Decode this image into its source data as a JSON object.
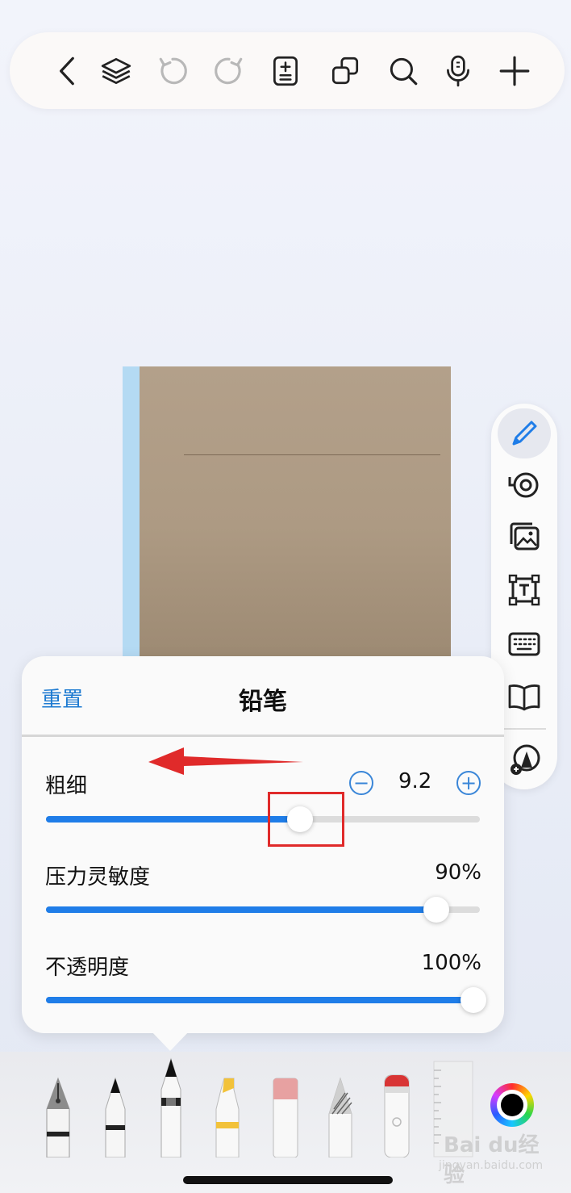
{
  "panel": {
    "reset_label": "重置",
    "title": "铅笔",
    "thickness": {
      "label": "粗细",
      "value": "9.2",
      "minus": "−",
      "plus": "+",
      "fraction": 0.585
    },
    "pressure": {
      "label": "压力灵敏度",
      "value": "90%",
      "fraction": 0.9
    },
    "opacity": {
      "label": "不透明度",
      "value": "100%",
      "fraction": 1.0
    }
  },
  "watermark": {
    "text": "Bai du经验",
    "sub": "jingyan.baidu.com"
  },
  "colors": {
    "accent": "#1f7de8",
    "annotation": "#e02a2a",
    "current_ink": "#000000"
  },
  "icons": {
    "toolbar": [
      "back-icon",
      "layers-icon",
      "undo-icon",
      "redo-icon",
      "page-add-icon",
      "copy-icon",
      "search-icon",
      "microphone-icon",
      "add-icon"
    ],
    "side_tools": [
      "pencil-icon",
      "tape-icon",
      "image-icon",
      "textbox-icon",
      "keyboard-icon",
      "book-icon",
      "shapes-icon"
    ],
    "pen_tray": [
      "fountain-pen",
      "ball-pen",
      "pencil",
      "highlighter",
      "eraser",
      "pattern-pen",
      "lasso-pen",
      "ruler",
      "color-picker"
    ]
  }
}
